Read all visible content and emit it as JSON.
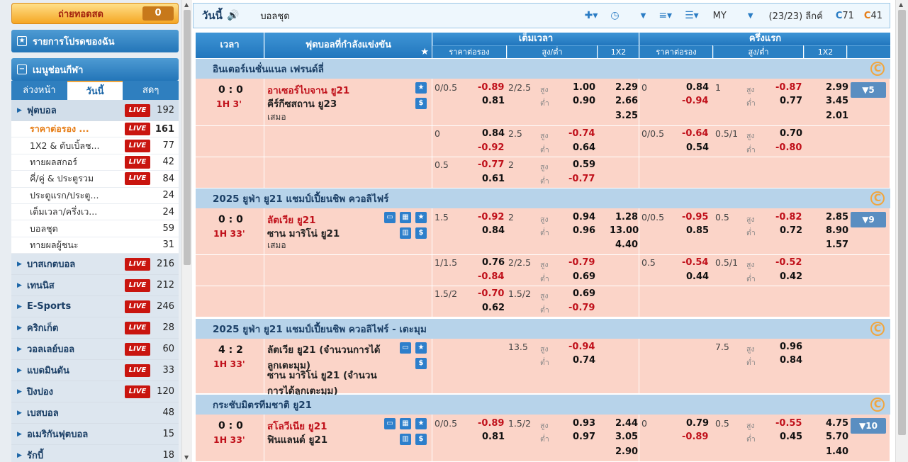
{
  "sidebar": {
    "live_label": "ถ่ายทอดสด",
    "live_count": "0",
    "favorites_label": "รายการโปรดของฉัน",
    "sports_menu_label": "เมนูช่อนกีฬา",
    "tabs": [
      "ล่วงหน้า",
      "วันนี้",
      "สดๆ"
    ],
    "sports": [
      {
        "name": "ฟุตบอล",
        "live": "LIVE",
        "count": "192"
      },
      {
        "name": "บาสเกตบอล",
        "live": "LIVE",
        "count": "216"
      },
      {
        "name": "เทนนิส",
        "live": "LIVE",
        "count": "212"
      },
      {
        "name": "E-Sports",
        "live": "LIVE",
        "count": "246"
      },
      {
        "name": "คริกเก็ต",
        "live": "LIVE",
        "count": "28"
      },
      {
        "name": "วอลเลย์บอล",
        "live": "LIVE",
        "count": "60"
      },
      {
        "name": "แบดมินตัน",
        "live": "LIVE",
        "count": "33"
      },
      {
        "name": "ปิงปอง",
        "live": "LIVE",
        "count": "120"
      },
      {
        "name": "เบสบอล",
        "count": "48"
      },
      {
        "name": "อเมริกันฟุตบอล",
        "count": "15"
      },
      {
        "name": "รักบี้",
        "count": "18"
      }
    ],
    "football_sub": [
      {
        "name": "ราคาต่อรอง ...",
        "live": "LIVE",
        "count": "161"
      },
      {
        "name": "1X2 & ดับเบิ้ลช...",
        "live": "LIVE",
        "count": "77"
      },
      {
        "name": "ทายผลสกอร์",
        "live": "LIVE",
        "count": "42"
      },
      {
        "name": "คี่/คู่ & ประตูรวม",
        "live": "LIVE",
        "count": "84"
      },
      {
        "name": "ประตูแรก/ประตู...",
        "count": "24"
      },
      {
        "name": "เต็มเวลา/ครึ่งเว...",
        "count": "24"
      },
      {
        "name": "บอลชุด",
        "count": "59"
      },
      {
        "name": "ทายผลผู้ชนะ",
        "count": "31"
      }
    ]
  },
  "topbar": {
    "title": "วันนี้",
    "league": "บอลชุด",
    "odds_type": "MY",
    "page": "(23/23) ลีกค์",
    "refresh_1": "71",
    "refresh_2": "41"
  },
  "table": {
    "col_time": "เวลา",
    "col_match": "ฟุตบอลที่กำลังแข่งขัน",
    "col_fulltime": "เต็มเวลา",
    "col_firsthalf": "ครึ่งแรก",
    "sub_hdp": "ราคาต่อรอง",
    "sub_ou": "สูง/ต่ำ",
    "sub_1x2": "1X2",
    "over_label": "สูง",
    "under_label": "ต่ำ"
  },
  "leagues": [
    {
      "name": "อินเตอร์เนชั่นแนล เฟรนด์ลี่",
      "score": "0 : 0",
      "time": "1H 3'",
      "home": "อาเซอร์ไบจาน ยู21",
      "away": "คีร์กีซสถาน ยู23",
      "draw": "เสมอ",
      "more": "▼5",
      "rows": [
        {
          "fh": "0/0.5",
          "fh1": "-0.89",
          "fh2": "0.81",
          "fo": "2/2.5",
          "fo1": "1.00",
          "fo2": "0.90",
          "x1": "2.29",
          "x2": "2.66",
          "x3": "3.25",
          "hh": "0",
          "hh1": "0.84",
          "hh2": "-0.94",
          "ho": "1",
          "ho1": "-0.87",
          "ho2": "0.77",
          "hx1": "2.99",
          "hx2": "3.45",
          "hx3": "2.01"
        },
        {
          "fh": "0",
          "fh1": "0.84",
          "fh2": "-0.92",
          "fo": "2.5",
          "fo1": "-0.74",
          "fo2": "0.64",
          "hh": "0/0.5",
          "hh1": "-0.64",
          "hh2": "0.54",
          "ho": "0.5/1",
          "ho1": "0.70",
          "ho2": "-0.80"
        },
        {
          "fh": "0.5",
          "fh1": "-0.77",
          "fh2": "0.61",
          "fo": "2",
          "fo1": "0.59",
          "fo2": "-0.77"
        }
      ]
    },
    {
      "name": "2025 ยูฟ่า ยู21 แชมป์เปี้ยนชิพ ควอลิไฟร์",
      "score": "0 : 0",
      "time": "1H 33'",
      "home": "ลัตเวีย ยู21",
      "away": "ซาน มาริโน่ ยู21",
      "draw": "เสมอ",
      "more": "▼9",
      "rows": [
        {
          "fh": "1.5",
          "fh1": "-0.92",
          "fh2": "0.84",
          "fo": "2",
          "fo1": "0.94",
          "fo2": "0.96",
          "x1": "1.28",
          "x2": "13.00",
          "x3": "4.40",
          "hh": "0/0.5",
          "hh1": "-0.95",
          "hh2": "0.85",
          "ho": "0.5",
          "ho1": "-0.82",
          "ho2": "0.72",
          "hx1": "2.85",
          "hx2": "8.90",
          "hx3": "1.57"
        },
        {
          "fh": "1/1.5",
          "fh1": "0.76",
          "fh2": "-0.84",
          "fo": "2/2.5",
          "fo1": "-0.79",
          "fo2": "0.69",
          "hh": "0.5",
          "hh1": "-0.54",
          "hh2": "0.44",
          "ho": "0.5/1",
          "ho1": "-0.52",
          "ho2": "0.42"
        },
        {
          "fh": "1.5/2",
          "fh1": "-0.70",
          "fh2": "0.62",
          "fo": "1.5/2",
          "fo1": "0.69",
          "fo2": "-0.79"
        }
      ]
    },
    {
      "name": "2025 ยูฟ่า ยู21 แชมป์เปี้ยนชิพ ควอลิไฟร์ - เตะมุม",
      "score": "4 : 2",
      "time": "1H 33'",
      "home": "ลัตเวีย ยู21 (จำนวนการได้ลูกเตะมุม)",
      "home_l1": "ลัตเวีย ยู21 (จำนวนการได้",
      "home_l2": "ลูกเตะมุม)",
      "away_l1": "ซาน มาริโน่ ยู21 (จำนวน",
      "away_l2": "การได้ลูกเตะมุม)",
      "rows": [
        {
          "fo": "13.5",
          "fo1": "-0.94",
          "fo2": "0.74",
          "ho": "7.5",
          "ho1": "0.96",
          "ho2": "0.84"
        }
      ]
    },
    {
      "name": "กระชับมิตรทีมชาติ ยู21",
      "score": "0 : 0",
      "time": "1H 33'",
      "home": "สโลวีเนีย ยู21",
      "away": "ฟินแลนด์ ยู21",
      "more": "▼10",
      "rows": [
        {
          "fh": "0/0.5",
          "fh1": "-0.89",
          "fh2": "0.81",
          "fo": "1.5/2",
          "fo1": "0.93",
          "fo2": "0.97",
          "x1": "2.44",
          "x2": "3.05",
          "x3": "2.90",
          "hh": "0",
          "hh1": "0.79",
          "hh2": "-0.89",
          "ho": "0.5",
          "ho1": "-0.55",
          "ho2": "0.45",
          "hx1": "4.75",
          "hx2": "5.70",
          "hx3": "1.40"
        }
      ]
    }
  ]
}
